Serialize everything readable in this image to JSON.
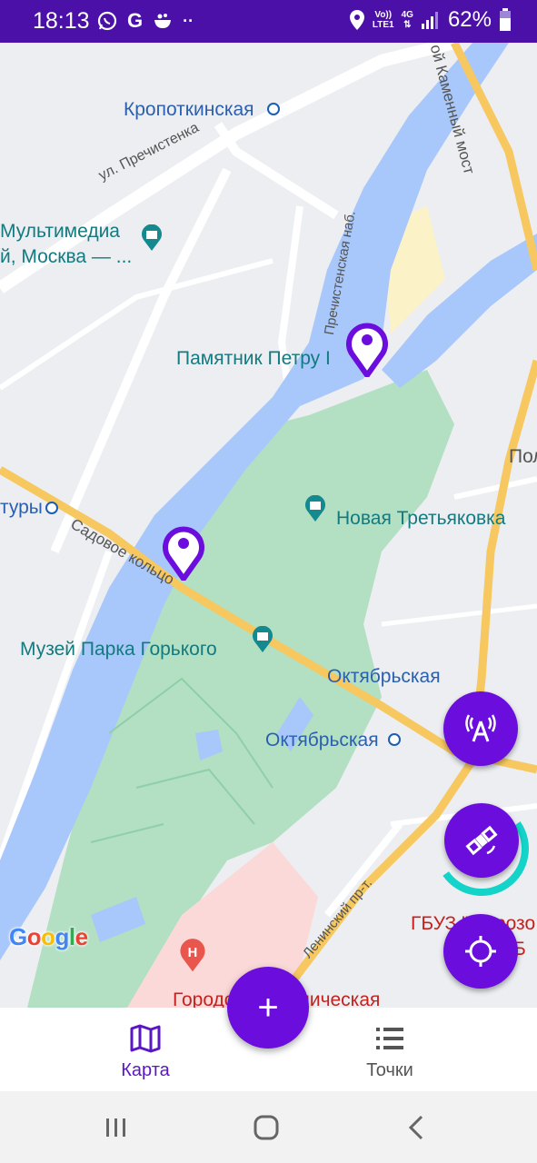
{
  "status_bar": {
    "time": "18:13",
    "left_icons": [
      "whatsapp-icon",
      "google-icon",
      "app-icon",
      "more-dots-icon"
    ],
    "network": {
      "line1": "Vo))",
      "line2": "LTE1",
      "type": "4G"
    },
    "battery_percent": "62%"
  },
  "map": {
    "labels": {
      "kropotkinskaya": "Кропоткинская",
      "prechistenka": "ул. Пречистенка",
      "multimedia_1": "Мультимедиа",
      "multimedia_2": "й, Москва — ...",
      "prechistenskaya_nab": "Пречистенская наб.",
      "petr_monument": "Памятник Петру I",
      "kamenny_most": "ой Каменный мост",
      "pol": "Пол",
      "tury": "туры",
      "sadovoe": "Садовое кольцо",
      "new_tretyakov": "Новая Третьяковка",
      "gorky_museum": "Музей Парка Горького",
      "oktyabrskaya_1": "Октябрьская",
      "oktyabrskaya_2": "Октябрьская",
      "leninsky": "Ленинский пр-т.",
      "gbuz": "ГБУЗ \"Морозо",
      "gbuz_2": "ТКБ",
      "city_hospital": "Городская клиническая",
      "google": "Google"
    },
    "colors": {
      "water": "#a8c7fa",
      "park": "#b3dfc3",
      "road": "#ffffff",
      "highway": "#f6c85f",
      "marker": "#6a0ddd"
    }
  },
  "fabs": {
    "antenna": "antenna-icon",
    "satellite": "satellite-icon",
    "locate": "crosshair-icon",
    "add": "+"
  },
  "bottom_nav": {
    "map_label": "Карта",
    "points_label": "Точки"
  }
}
